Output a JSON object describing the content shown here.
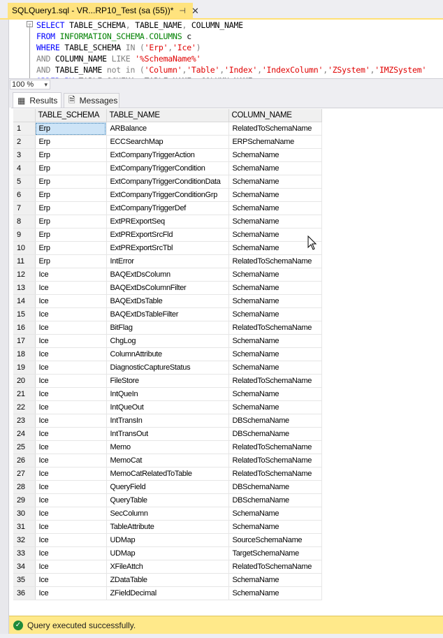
{
  "document_tab": {
    "title": "SQLQuery1.sql - VR...RP10_Test (sa (55))*",
    "pin_glyph": "⊣",
    "close_glyph": "✕"
  },
  "editor": {
    "outline_glyph": "−",
    "lines": [
      [
        {
          "t": "SELECT",
          "c": "kw"
        },
        {
          "t": " TABLE_SCHEMA",
          "c": "ident"
        },
        {
          "t": ",",
          "c": "op"
        },
        {
          "t": " TABLE_NAME",
          "c": "ident"
        },
        {
          "t": ",",
          "c": "op"
        },
        {
          "t": " COLUMN_NAME",
          "c": "ident"
        }
      ],
      [
        {
          "t": "FROM",
          "c": "kw"
        },
        {
          "t": " INFORMATION_SCHEMA",
          "c": "sys"
        },
        {
          "t": ".",
          "c": "op"
        },
        {
          "t": "COLUMNS",
          "c": "sys"
        },
        {
          "t": " c",
          "c": "ident"
        }
      ],
      [
        {
          "t": "WHERE",
          "c": "kw"
        },
        {
          "t": " TABLE_SCHEMA ",
          "c": "ident"
        },
        {
          "t": "IN",
          "c": "op"
        },
        {
          "t": " (",
          "c": "op"
        },
        {
          "t": "'Erp'",
          "c": "str"
        },
        {
          "t": ",",
          "c": "op"
        },
        {
          "t": "'Ice'",
          "c": "str"
        },
        {
          "t": ")",
          "c": "op"
        }
      ],
      [
        {
          "t": "AND",
          "c": "op"
        },
        {
          "t": " COLUMN_NAME ",
          "c": "ident"
        },
        {
          "t": "LIKE",
          "c": "op"
        },
        {
          "t": " ",
          "c": "ident"
        },
        {
          "t": "'%SchemaName%'",
          "c": "str"
        }
      ],
      [
        {
          "t": "AND",
          "c": "op"
        },
        {
          "t": " TABLE_NAME ",
          "c": "ident"
        },
        {
          "t": "not in",
          "c": "op"
        },
        {
          "t": " (",
          "c": "op"
        },
        {
          "t": "'Column'",
          "c": "str"
        },
        {
          "t": ",",
          "c": "op"
        },
        {
          "t": "'Table'",
          "c": "str"
        },
        {
          "t": ",",
          "c": "op"
        },
        {
          "t": "'Index'",
          "c": "str"
        },
        {
          "t": ",",
          "c": "op"
        },
        {
          "t": "'IndexColumn'",
          "c": "str"
        },
        {
          "t": ",",
          "c": "op"
        },
        {
          "t": "'ZSystem'",
          "c": "str"
        },
        {
          "t": ",",
          "c": "op"
        },
        {
          "t": "'IMZSystem'",
          "c": "str"
        }
      ],
      [
        {
          "t": "ORDER BY",
          "c": "kw"
        },
        {
          "t": " TABLE_SCHEMA",
          "c": "ident"
        },
        {
          "t": ",",
          "c": "op"
        },
        {
          "t": " TABLE_NAME",
          "c": "ident"
        },
        {
          "t": ",",
          "c": "op"
        },
        {
          "t": " COLUMN_NAME",
          "c": "ident"
        }
      ]
    ]
  },
  "zoom": {
    "value": "100 %",
    "arrow": "▾"
  },
  "results_tabs": {
    "results_label": "Results",
    "messages_label": "Messages",
    "results_icon": "▦",
    "messages_icon": "🗎"
  },
  "grid": {
    "columns": [
      "TABLE_SCHEMA",
      "TABLE_NAME",
      "COLUMN_NAME"
    ],
    "selected_row": 0,
    "rows": [
      [
        "1",
        "Erp",
        "ARBalance",
        "RelatedToSchemaName"
      ],
      [
        "2",
        "Erp",
        "ECCSearchMap",
        "ERPSchemaName"
      ],
      [
        "3",
        "Erp",
        "ExtCompanyTriggerAction",
        "SchemaName"
      ],
      [
        "4",
        "Erp",
        "ExtCompanyTriggerCondition",
        "SchemaName"
      ],
      [
        "5",
        "Erp",
        "ExtCompanyTriggerConditionData",
        "SchemaName"
      ],
      [
        "6",
        "Erp",
        "ExtCompanyTriggerConditionGrp",
        "SchemaName"
      ],
      [
        "7",
        "Erp",
        "ExtCompanyTriggerDef",
        "SchemaName"
      ],
      [
        "8",
        "Erp",
        "ExtPRExportSeq",
        "SchemaName"
      ],
      [
        "9",
        "Erp",
        "ExtPRExportSrcFld",
        "SchemaName"
      ],
      [
        "10",
        "Erp",
        "ExtPRExportSrcTbl",
        "SchemaName"
      ],
      [
        "11",
        "Erp",
        "IntError",
        "RelatedToSchemaName"
      ],
      [
        "12",
        "Ice",
        "BAQExtDsColumn",
        "SchemaName"
      ],
      [
        "13",
        "Ice",
        "BAQExtDsColumnFilter",
        "SchemaName"
      ],
      [
        "14",
        "Ice",
        "BAQExtDsTable",
        "SchemaName"
      ],
      [
        "15",
        "Ice",
        "BAQExtDsTableFilter",
        "SchemaName"
      ],
      [
        "16",
        "Ice",
        "BitFlag",
        "RelatedToSchemaName"
      ],
      [
        "17",
        "Ice",
        "ChgLog",
        "SchemaName"
      ],
      [
        "18",
        "Ice",
        "ColumnAttribute",
        "SchemaName"
      ],
      [
        "19",
        "Ice",
        "DiagnosticCaptureStatus",
        "SchemaName"
      ],
      [
        "20",
        "Ice",
        "FileStore",
        "RelatedToSchemaName"
      ],
      [
        "21",
        "Ice",
        "IntQueIn",
        "SchemaName"
      ],
      [
        "22",
        "Ice",
        "IntQueOut",
        "SchemaName"
      ],
      [
        "23",
        "Ice",
        "IntTransIn",
        "DBSchemaName"
      ],
      [
        "24",
        "Ice",
        "IntTransOut",
        "DBSchemaName"
      ],
      [
        "25",
        "Ice",
        "Memo",
        "RelatedToSchemaName"
      ],
      [
        "26",
        "Ice",
        "MemoCat",
        "RelatedToSchemaName"
      ],
      [
        "27",
        "Ice",
        "MemoCatRelatedToTable",
        "RelatedToSchemaName"
      ],
      [
        "28",
        "Ice",
        "QueryField",
        "DBSchemaName"
      ],
      [
        "29",
        "Ice",
        "QueryTable",
        "DBSchemaName"
      ],
      [
        "30",
        "Ice",
        "SecColumn",
        "SchemaName"
      ],
      [
        "31",
        "Ice",
        "TableAttribute",
        "SchemaName"
      ],
      [
        "32",
        "Ice",
        "UDMap",
        "SourceSchemaName"
      ],
      [
        "33",
        "Ice",
        "UDMap",
        "TargetSchemaName"
      ],
      [
        "34",
        "Ice",
        "XFileAttch",
        "RelatedToSchemaName"
      ],
      [
        "35",
        "Ice",
        "ZDataTable",
        "SchemaName"
      ],
      [
        "36",
        "Ice",
        "ZFieldDecimal",
        "SchemaName"
      ]
    ]
  },
  "status": {
    "text": "Query executed successfully.",
    "icon": "✓"
  },
  "colors": {
    "tab_accent": "#ffe37e",
    "status_bar": "#ffe98a",
    "selection": "#cde4f7"
  }
}
